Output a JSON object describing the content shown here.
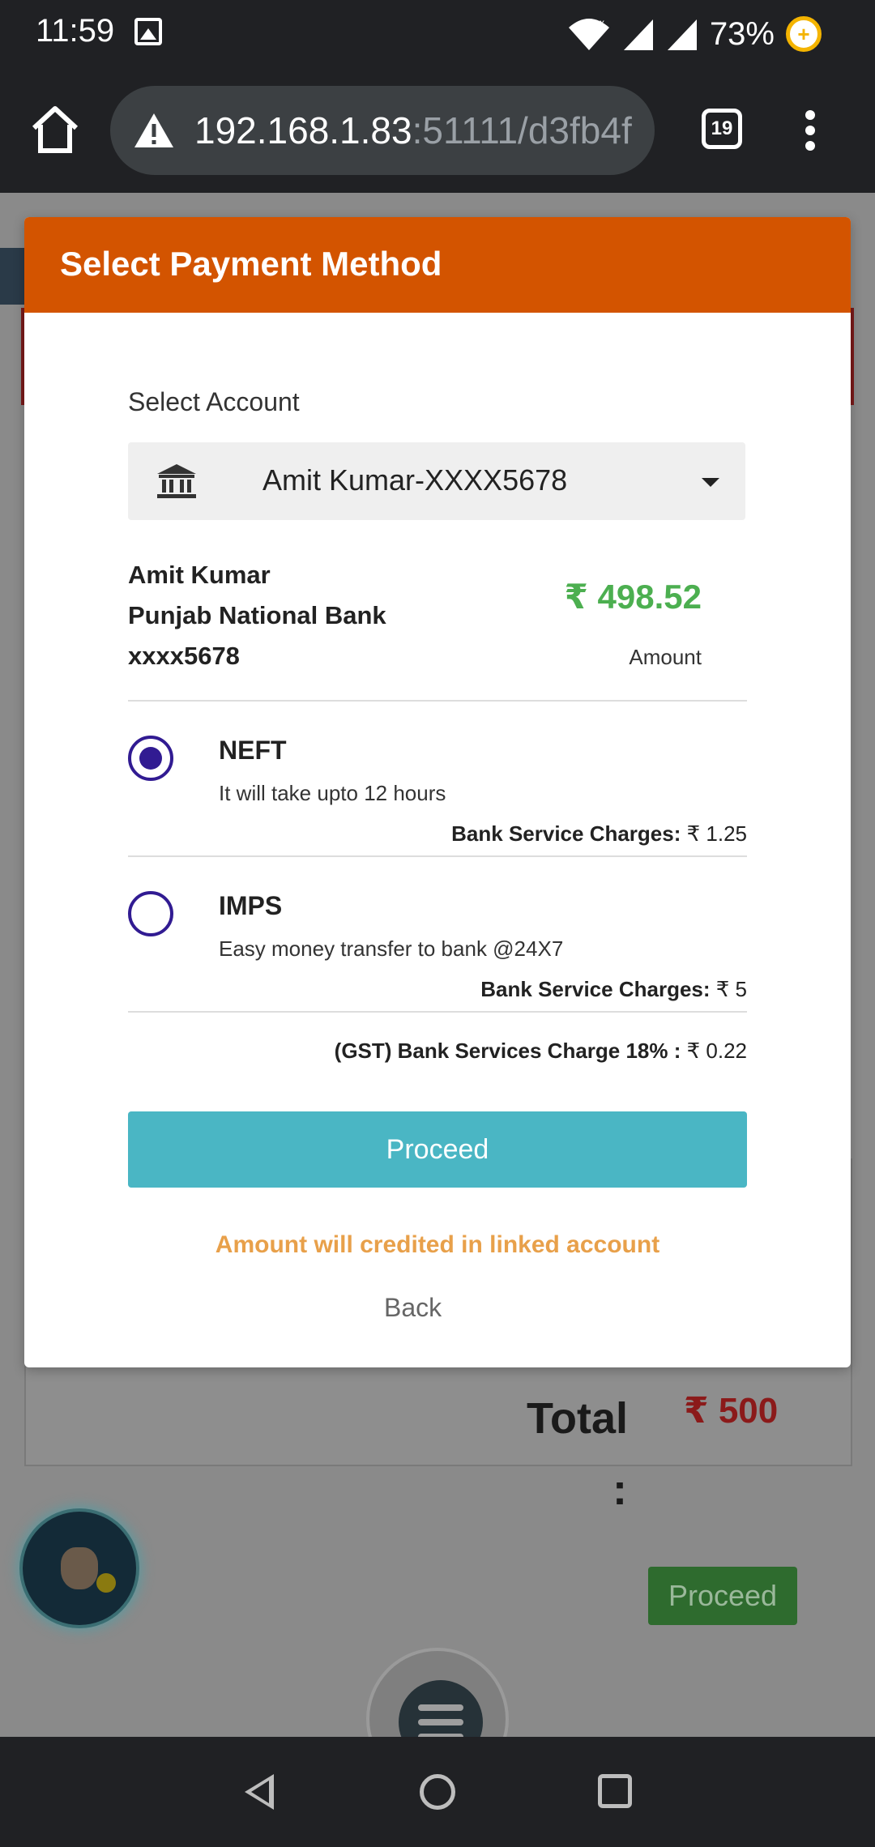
{
  "status_bar": {
    "time": "11:59",
    "battery": "73%"
  },
  "browser": {
    "url_host": "192.168.1.83",
    "url_rest": ":51111/d3fb4f",
    "tab_count": "19"
  },
  "modal": {
    "title": "Select Payment Method",
    "select_label": "Select Account",
    "selected_account": "Amit Kumar-XXXX5678",
    "account_name": "Amit Kumar",
    "bank_name": "Punjab National Bank",
    "account_number": "xxxx5678",
    "amount": "₹ 498.52",
    "amount_label": "Amount",
    "options": [
      {
        "title": "NEFT",
        "description": "It will take upto 12 hours",
        "charge_label": "Bank Service Charges:",
        "charge_value": "₹ 1.25",
        "selected": true
      },
      {
        "title": "IMPS",
        "description": "Easy money transfer to bank @24X7",
        "charge_label": "Bank Service Charges:",
        "charge_value": "₹ 5",
        "selected": false
      }
    ],
    "gst_label": "(GST) Bank Services Charge 18% :",
    "gst_value": "₹ 0.22",
    "proceed_label": "Proceed",
    "notice": "Amount will credited in linked account",
    "back_label": "Back"
  },
  "background": {
    "total_label": "Total",
    "total_colon": ":",
    "total_value": "₹ 500",
    "proceed_label": "Proceed"
  },
  "colors": {
    "header": "#d35400",
    "proceed_button": "#4ab6c4",
    "amount": "#4caf50",
    "notice": "#e8a04a",
    "radio": "#311b92"
  }
}
